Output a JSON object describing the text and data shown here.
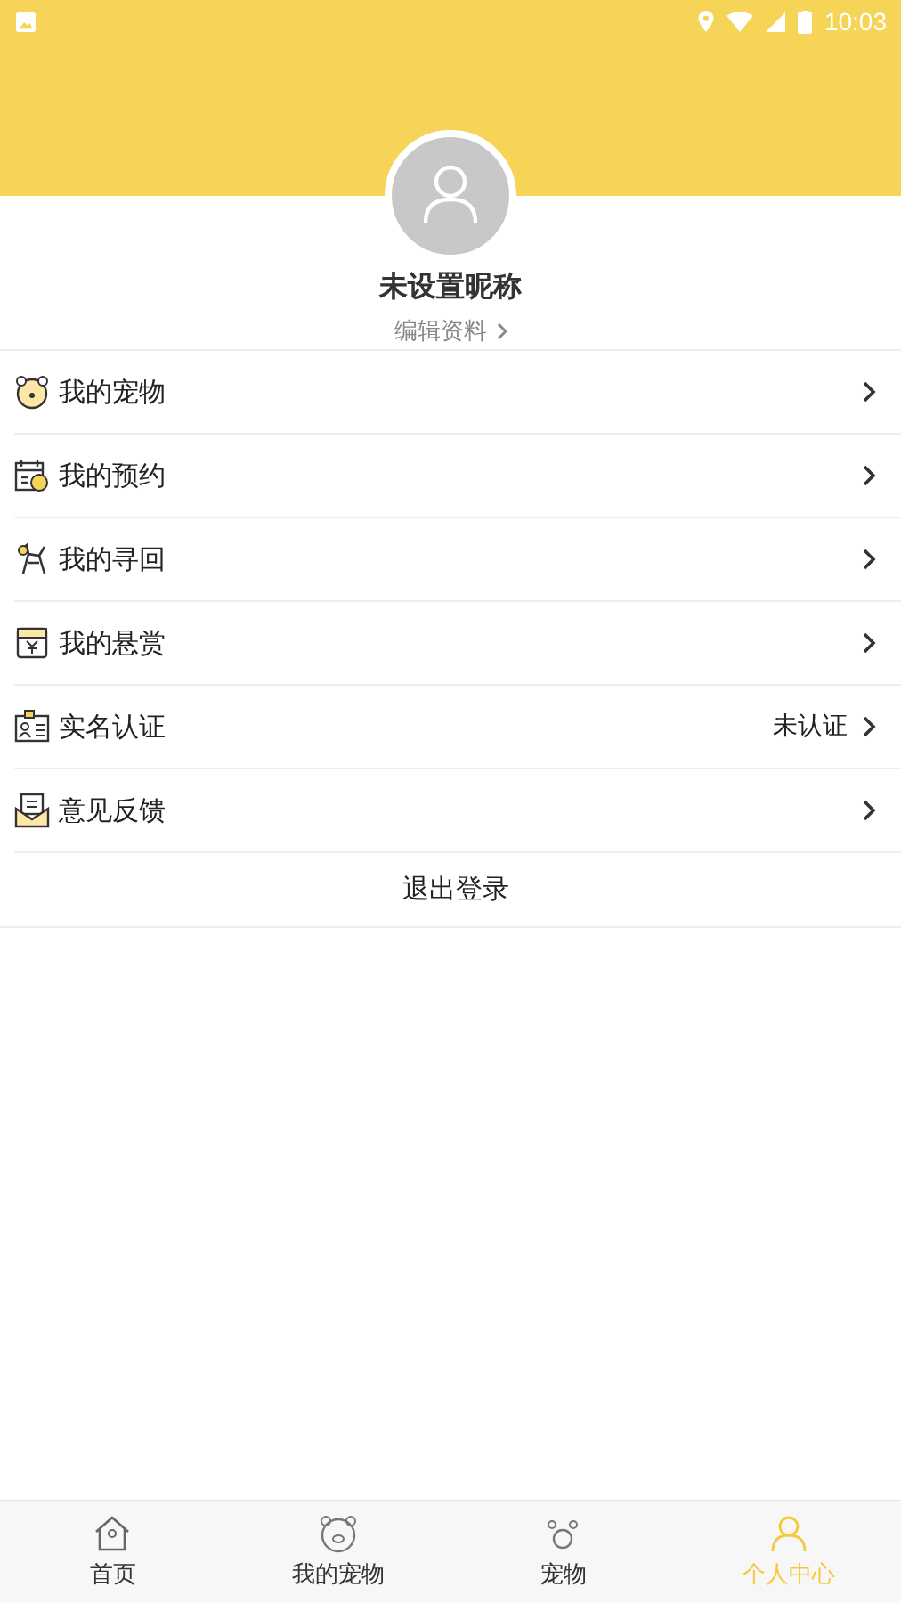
{
  "status_bar": {
    "time": "10:03"
  },
  "profile": {
    "nickname": "未设置昵称",
    "edit_link": "编辑资料"
  },
  "menu": [
    {
      "kind": "pet",
      "label": "我的宠物"
    },
    {
      "kind": "booking",
      "label": "我的预约"
    },
    {
      "kind": "search",
      "label": "我的寻回"
    },
    {
      "kind": "reward",
      "label": "我的悬赏"
    },
    {
      "kind": "idcard",
      "label": "实名认证",
      "value": "未认证"
    },
    {
      "kind": "feedback",
      "label": "意见反馈"
    }
  ],
  "logout": "退出登录",
  "tabs": [
    {
      "kind": "home",
      "label": "首页",
      "selected": false
    },
    {
      "kind": "pet",
      "label": "我的宠物",
      "selected": false
    },
    {
      "kind": "circle",
      "label": "宠物",
      "selected": false
    },
    {
      "kind": "user",
      "label": "个人中心",
      "selected": true
    }
  ]
}
